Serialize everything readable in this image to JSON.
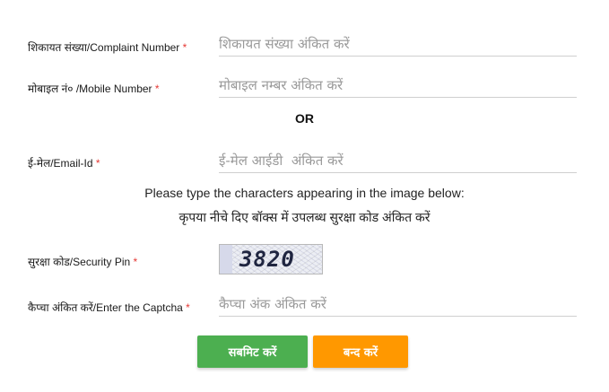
{
  "form": {
    "complaint_number": {
      "label": "शिकायत संख्या/Complaint Number",
      "required_mark": "*",
      "placeholder": "शिकायत संख्या अंकित करें"
    },
    "mobile_number": {
      "label": "मोबाइल नं० /Mobile Number",
      "required_mark": "*",
      "placeholder": "मोबाइल नम्बर अंकित करें"
    },
    "or_text": "OR",
    "email": {
      "label": "ई-मेल/Email-Id",
      "required_mark": "*",
      "placeholder": "ई-मेल आईडी  अंकित करें"
    },
    "instruction_en": "Please type the characters appearing in the image below:",
    "instruction_hi": "कृपया नीचे दिए बॉक्स में उपलब्ध सुरक्षा कोड अंकित करें",
    "security_pin": {
      "label": "सुरक्षा कोड/Security Pin",
      "required_mark": "*",
      "captcha_text": "3820"
    },
    "captcha": {
      "label": "कैप्चा अंकित करें/Enter the Captcha",
      "required_mark": "*",
      "placeholder": "कैप्चा अंक अंकित करें"
    }
  },
  "buttons": {
    "submit": "सबमिट करें",
    "close": "बन्द करें"
  },
  "colors": {
    "submit": "#4caf50",
    "close": "#ff9800",
    "required": "#e53935"
  }
}
